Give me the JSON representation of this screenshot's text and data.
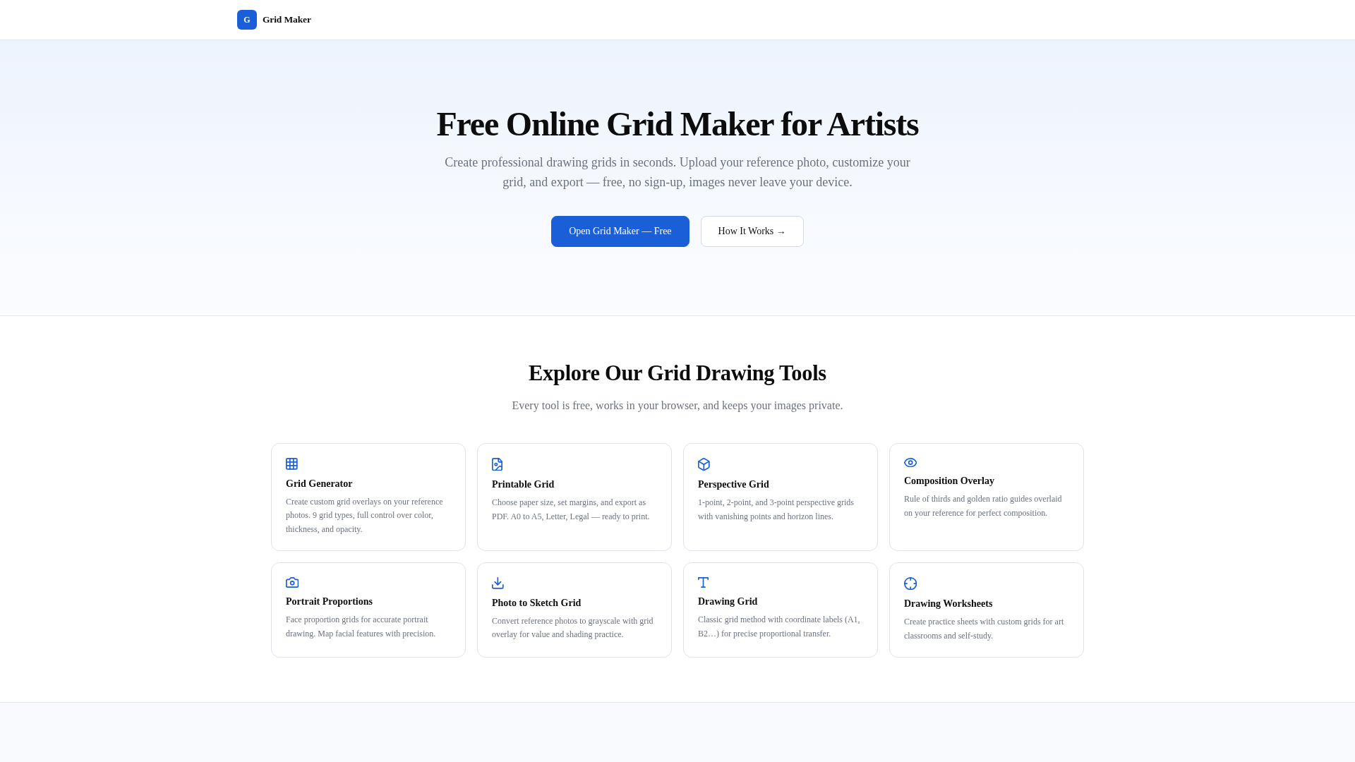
{
  "header": {
    "logo": {
      "letter": "G",
      "name": "Grid Maker"
    }
  },
  "hero": {
    "title": "Free Online Grid Maker for Artists",
    "subtitle": "Create professional drawing grids in seconds. Upload your reference photo, customize your grid, and export — free, no sign-up, images never leave your device.",
    "buttons": [
      {
        "label": "Open Grid Maker — Free",
        "kind": "primary"
      },
      {
        "label": "How It Works →",
        "kind": "secondary"
      }
    ]
  },
  "tools": {
    "title": "Explore Our Grid Drawing Tools",
    "subtitle": "Every tool is free, works in your browser, and keeps your images private.",
    "cards": [
      {
        "title": "Grid Generator",
        "description": "Create custom grid overlays on your reference photos. 9 grid types, full control over color, thickness, and opacity."
      },
      {
        "title": "Printable Grid",
        "description": "Choose paper size, set margins, and export as PDF. A0 to A5, Letter, Legal — ready to print."
      },
      {
        "title": "Perspective Grid",
        "description": "1-point, 2-point, and 3-point perspective grids with vanishing points and horizon lines."
      },
      {
        "title": "Composition Overlay",
        "description": "Rule of thirds and golden ratio guides overlaid on your reference for perfect composition."
      },
      {
        "title": "Portrait Proportions",
        "description": "Face proportion grids for accurate portrait drawing. Map facial features with precision."
      },
      {
        "title": "Photo to Sketch Grid",
        "description": "Convert reference photos to grayscale with grid overlay for value and shading practice."
      },
      {
        "title": "Drawing Grid",
        "description": "Classic grid method with coordinate labels (A1, B2…) for precise proportional transfer."
      },
      {
        "title": "Drawing Worksheets",
        "description": "Create practice sheets with custom grids for art classrooms and self-study."
      }
    ]
  }
}
